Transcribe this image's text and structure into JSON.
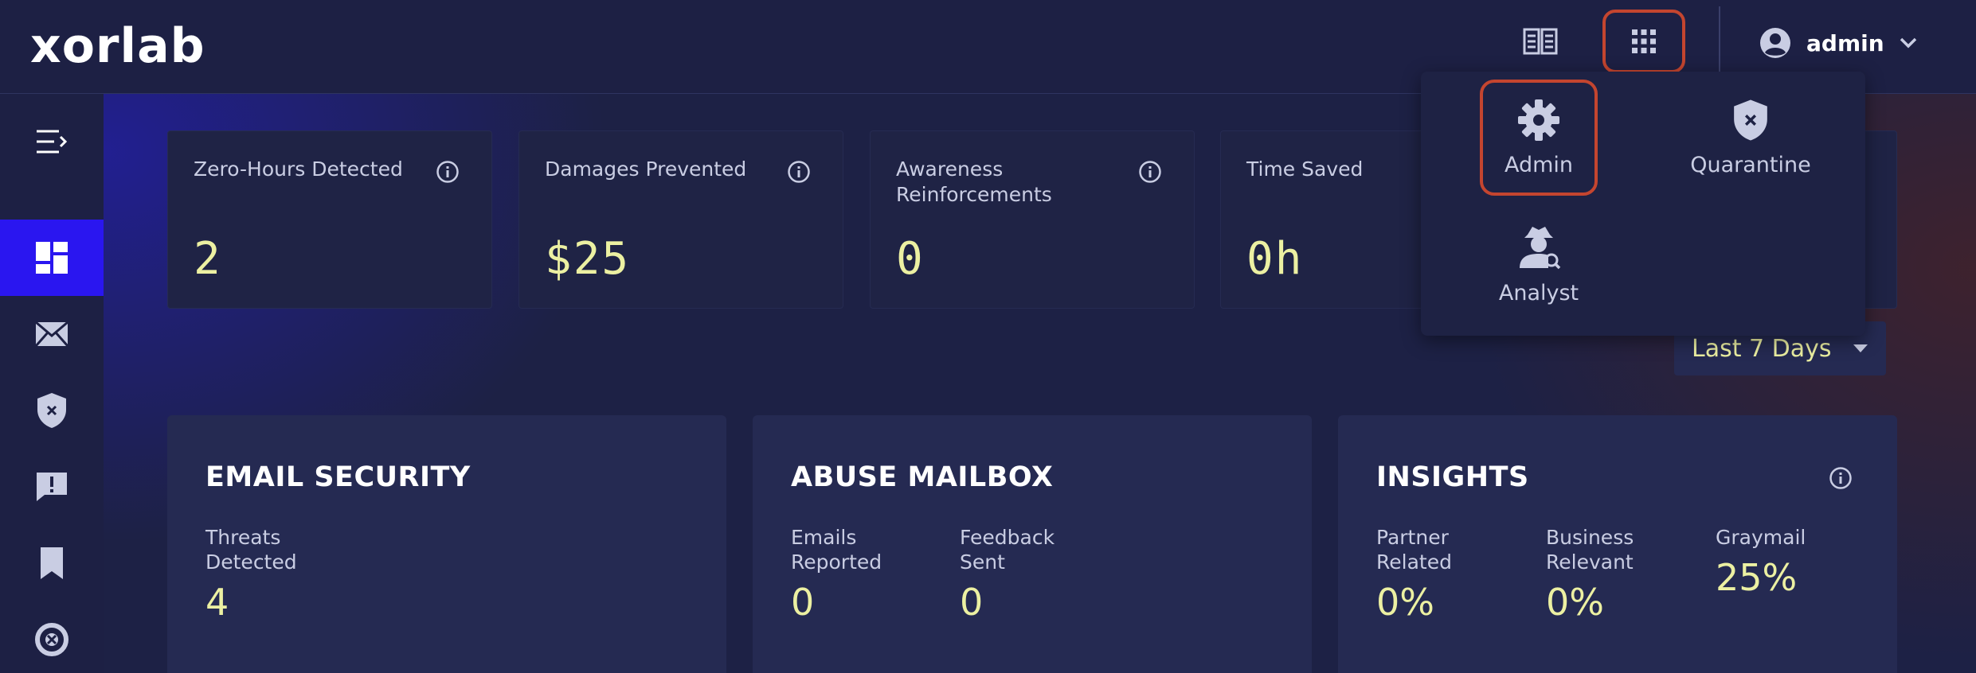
{
  "app": {
    "logo": "xorlab"
  },
  "topbar": {
    "docs_icon": "book-open-icon",
    "apps_icon": "apps-grid-icon",
    "user": {
      "name": "admin",
      "avatar_icon": "user-circle-icon",
      "chevron_icon": "chevron-down-icon"
    }
  },
  "sidebar": {
    "items": [
      {
        "icon": "menu-collapse-icon"
      },
      {
        "icon": "dashboard-icon",
        "active": true
      },
      {
        "icon": "mail-icon"
      },
      {
        "icon": "shield-x-icon"
      },
      {
        "icon": "chat-alert-icon"
      },
      {
        "icon": "bookmark-icon"
      },
      {
        "icon": "lifebuoy-icon"
      }
    ]
  },
  "stats": [
    {
      "label": "Zero-Hours Detected",
      "value": "2"
    },
    {
      "label": "Damages Prevented",
      "value": "$25"
    },
    {
      "label": "Awareness Reinforcements",
      "value": "0"
    },
    {
      "label": "Time Saved",
      "value": "0h"
    }
  ],
  "filter": {
    "selected": "Last 7 Days"
  },
  "sections": {
    "email_security": {
      "title": "EMAIL SECURITY",
      "metrics": [
        {
          "label": "Threats Detected",
          "value": "4"
        }
      ]
    },
    "abuse_mailbox": {
      "title": "ABUSE MAILBOX",
      "metrics": [
        {
          "label": "Emails Reported",
          "value": "0"
        },
        {
          "label": "Feedback Sent",
          "value": "0"
        }
      ]
    },
    "insights": {
      "title": "INSIGHTS",
      "metrics": [
        {
          "label": "Partner Related",
          "value": "0%"
        },
        {
          "label": "Business Relevant",
          "value": "0%"
        },
        {
          "label": "Graymail",
          "value": "25%"
        }
      ]
    }
  },
  "apps_menu": {
    "items": [
      {
        "label": "Admin",
        "icon": "gear-icon",
        "selected": true
      },
      {
        "label": "Quarantine",
        "icon": "shield-x-icon"
      },
      {
        "label": "Analyst",
        "icon": "analyst-icon"
      }
    ]
  },
  "colors": {
    "accent_active": "#2a16f0",
    "value_yellow": "#ecf0a2",
    "highlight": "#c4452f"
  }
}
